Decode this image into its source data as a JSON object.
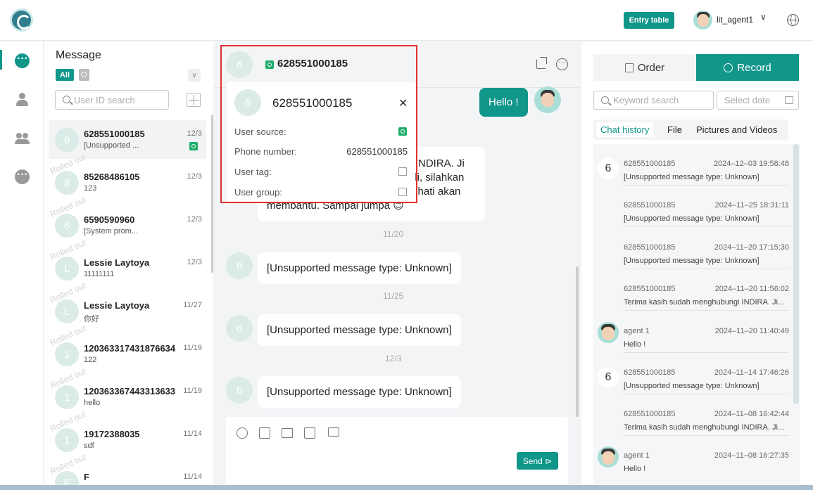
{
  "topbar": {
    "entry_table_label": "Entry table",
    "agent_name": "lit_agent1",
    "dropdown_glyph": "∨"
  },
  "conversations": {
    "title": "Message",
    "filter_all": "All",
    "search_placeholder": "User ID search",
    "rolled_out_label": "Rolled out",
    "items": [
      {
        "avatar": "6",
        "name": "628551000185",
        "preview": "[Unsupported ...",
        "date": "12/3"
      },
      {
        "avatar": "8",
        "name": "85268486105",
        "preview": "123",
        "date": "12/3"
      },
      {
        "avatar": "6",
        "name": "6590590960",
        "preview": "[System prom...",
        "date": "12/3"
      },
      {
        "avatar": "L",
        "name": "Lessie Laytoya",
        "preview": "11111111",
        "date": "12/3"
      },
      {
        "avatar": "L",
        "name": "Lessie Laytoya",
        "preview": "你好",
        "date": "11/27"
      },
      {
        "avatar": "1",
        "name": "120363317431876634",
        "preview": "122",
        "date": "11/19"
      },
      {
        "avatar": "1",
        "name": "120363367443313633",
        "preview": "hello",
        "date": "11/19"
      },
      {
        "avatar": "1",
        "name": "19172388035",
        "preview": "sdf",
        "date": "11/14"
      },
      {
        "avatar": "F",
        "name": "F",
        "preview": "",
        "date": "11/14"
      }
    ]
  },
  "chat": {
    "header_avatar": "6",
    "header_name": "628551000185",
    "hello_message": "Hello !",
    "partial_message_lines": [
      "gi INDIRA. Ji",
      "ali, silahkan",
      "g hati akan",
      "membantu. Sampai jumpa 😊"
    ],
    "dates": [
      "11/20",
      "11/25",
      "12/3"
    ],
    "unsupported_message": "[Unsupported message type: Unknown]",
    "msg_avatar": "6",
    "send_label": "Send ⊳"
  },
  "profile_popup": {
    "avatar": "6",
    "name": "628551000185",
    "close_glyph": "✕",
    "user_source_label": "User source:",
    "phone_label": "Phone number:",
    "phone_value": "628551000185",
    "tag_label": "User tag:",
    "group_label": "User group:"
  },
  "right_panel": {
    "tab_order": "Order",
    "tab_record": "Record",
    "keyword_placeholder": "Keyword search",
    "date_placeholder": "Select date",
    "subtabs": [
      "Chat history",
      "File",
      "Pictures and Videos"
    ],
    "history": [
      {
        "avatar": "6",
        "sender": "628551000185",
        "time": "2024–12–03 19:58:48",
        "text": "[Unsupported message type: Unknown]"
      },
      {
        "avatar": "",
        "sender": "628551000185",
        "time": "2024–11–25 18:31:11",
        "text": "[Unsupported message type: Unknown]"
      },
      {
        "avatar": "",
        "sender": "628551000185",
        "time": "2024–11–20 17:15:30",
        "text": "[Unsupported message type: Unknown]"
      },
      {
        "avatar": "",
        "sender": "628551000185",
        "time": "2024–11–20 11:56:02",
        "text": "Terima kasih sudah menghubungi INDIRA. Ji..."
      },
      {
        "avatar": "agent",
        "sender": "agent 1",
        "time": "2024–11–20 11:40:49",
        "text": "Hello !"
      },
      {
        "avatar": "6",
        "sender": "628551000185",
        "time": "2024–11–14 17:46:26",
        "text": "[Unsupported message type: Unknown]"
      },
      {
        "avatar": "",
        "sender": "628551000185",
        "time": "2024–11–08 16:42:44",
        "text": "Terima kasih sudah menghubungi INDIRA. Ji..."
      },
      {
        "avatar": "agent",
        "sender": "agent 1",
        "time": "2024–11–08 16:27:35",
        "text": "Hello !"
      }
    ]
  },
  "colors": {
    "accent": "#11968a",
    "whatsapp": "#1fae6a",
    "highlight_border": "#e0312b"
  }
}
